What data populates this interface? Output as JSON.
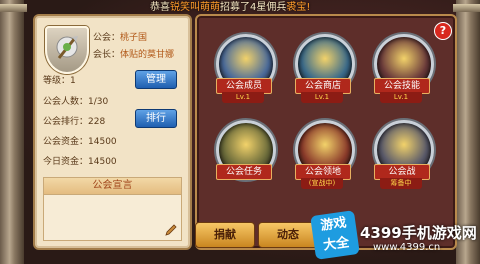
{
  "banner": {
    "prefix": "恭喜",
    "player": "锐笑叫萌萌",
    "middle": "招募了4星佣兵",
    "item": "裘宝!"
  },
  "guild": {
    "name_label": "公会：",
    "name": "桃子国",
    "leader_label": "会长：",
    "leader": "体贴的莫甘娜",
    "level_label": "等级：",
    "level": "1",
    "members_label": "公会人数：",
    "members": "1/30",
    "points_label": "公会排行：",
    "points": "228",
    "funds_label": "公会资金：",
    "funds": "14500",
    "today_label": "今日资金：",
    "today": "14500",
    "manage_button": "管理",
    "rank_button": "排行",
    "declaration_title": "公会宣言"
  },
  "tiles": [
    {
      "label": "公会成员",
      "sub": "Lv.1",
      "icon": "crown-shield-icon",
      "color": "#4a6a9a"
    },
    {
      "label": "公会商店",
      "sub": "Lv.1",
      "icon": "shop-tent-icon",
      "color": "#3a6a8a"
    },
    {
      "label": "公会技能",
      "sub": "Lv.1",
      "icon": "skill-book-icon",
      "color": "#6a3a3a"
    },
    {
      "label": "公会任务",
      "sub": "",
      "icon": "quest-helmet-icon",
      "color": "#6a6a3a"
    },
    {
      "label": "公会领地",
      "sub": "(宣战中)",
      "icon": "territory-tower-icon",
      "color": "#8a3a2a"
    },
    {
      "label": "公会战",
      "sub": "筹备中",
      "icon": "crossed-swords-icon",
      "color": "#5a5a6a"
    }
  ],
  "tabs": {
    "donate": "捐献",
    "news": "动态"
  },
  "help_label": "?",
  "watermark": {
    "badge_line1": "游戏",
    "badge_line2": "大全",
    "site_name": "4399手机游戏网",
    "site_url": "www.4399.cn"
  }
}
